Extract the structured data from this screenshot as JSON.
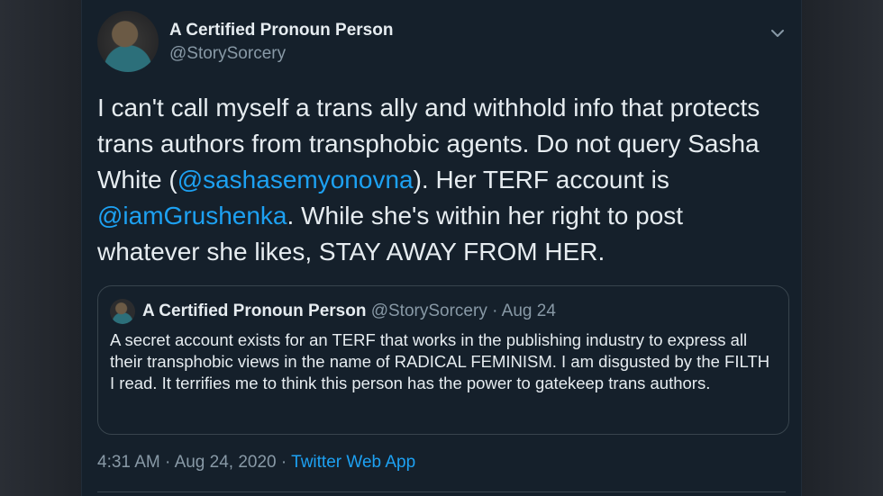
{
  "tweet": {
    "author_name": "A Certified Pronoun Person",
    "author_handle": "@StorySorcery",
    "menu_icon": "chevron-down-icon",
    "body": {
      "part1": "I can't call myself a trans ally and withhold info that protects trans authors from transphobic agents. Do not query Sasha White (",
      "mention1": "@sashasemyonovna",
      "part2": "). Her TERF account is ",
      "mention2": "@iamGrushenka",
      "part3": ". While she's within her right to post whatever she likes, STAY AWAY FROM HER."
    },
    "quoted": {
      "author_name": "A Certified Pronoun Person",
      "author_handle": "@StorySorcery",
      "separator": "·",
      "date": "Aug 24",
      "text": "A secret account exists for an TERF that works in the publishing industry to express all their transphobic views in the name of RADICAL FEMINISM. I am disgusted by the FILTH I read. It terrifies me to think this person has the power to gatekeep trans authors."
    },
    "footer": {
      "time": "4:31 AM",
      "separator": "·",
      "date": "Aug 24, 2020",
      "source": "Twitter Web App"
    }
  },
  "colors": {
    "background": "#15202b",
    "text": "#e6ecf0",
    "secondary": "#8899a6",
    "link": "#1da1f2",
    "border": "#38444d"
  }
}
